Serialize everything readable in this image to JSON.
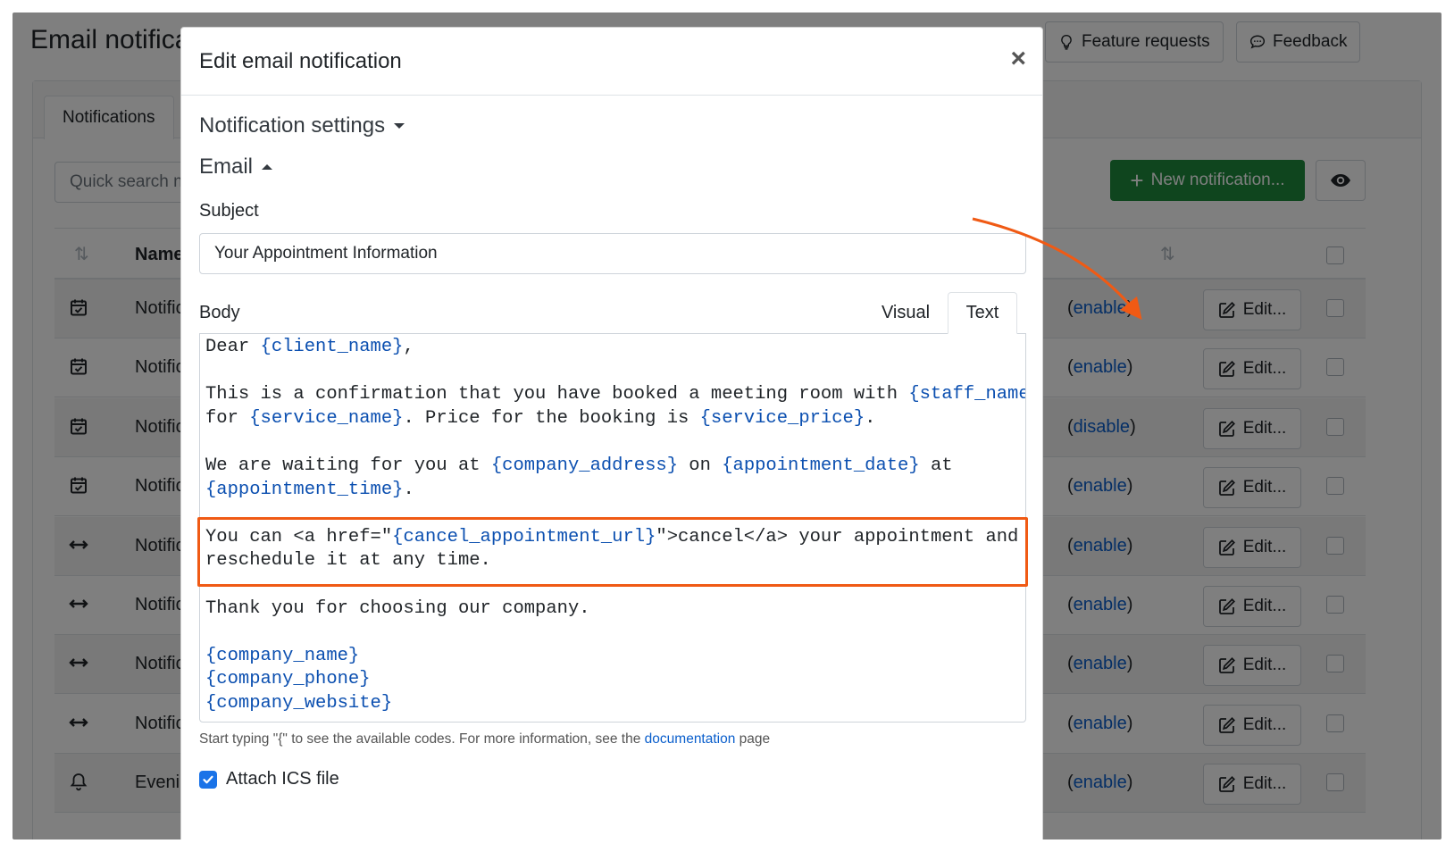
{
  "app": {
    "title": "Email notifica",
    "feature_requests": "Feature requests",
    "feedback": "Feedback",
    "tab_notifications": "Notifications",
    "search_placeholder": "Quick search n",
    "new_notification": "New notification...",
    "column_name": "Name",
    "rows": [
      {
        "icon": "calendar-check-icon",
        "name": "Notificat",
        "state_open": "(",
        "state_link": "enable",
        "state_close": ")",
        "edit": "Edit..."
      },
      {
        "icon": "calendar-check-icon",
        "name": "Notificat",
        "state_open": "(",
        "state_link": "enable",
        "state_close": ")",
        "edit": "Edit..."
      },
      {
        "icon": "calendar-check-icon",
        "name": "Notificat",
        "state_open": "(",
        "state_link": "disable",
        "state_close": ")",
        "edit": "Edit..."
      },
      {
        "icon": "calendar-check-icon",
        "name": "Notificat",
        "state_open": "(",
        "state_link": "enable",
        "state_close": ")",
        "edit": "Edit..."
      },
      {
        "icon": "arrows-horizontal-icon",
        "name": "Notificat",
        "state_open": "(",
        "state_link": "enable",
        "state_close": ")",
        "edit": "Edit..."
      },
      {
        "icon": "arrows-horizontal-icon",
        "name": "Notificat",
        "state_open": "(",
        "state_link": "enable",
        "state_close": ")",
        "edit": "Edit..."
      },
      {
        "icon": "arrows-horizontal-icon",
        "name": "Notificat",
        "state_open": "(",
        "state_link": "enable",
        "state_close": ")",
        "edit": "Edit..."
      },
      {
        "icon": "arrows-horizontal-icon",
        "name": "Notificat",
        "state_open": "(",
        "state_link": "enable",
        "state_close": ")",
        "edit": "Edit..."
      },
      {
        "icon": "bell-icon",
        "name": "Evening",
        "state_open": "(",
        "state_link": "enable",
        "state_close": ")",
        "edit": "Edit..."
      }
    ]
  },
  "modal": {
    "title": "Edit email notification",
    "close": "×",
    "notification_settings": "Notification settings",
    "email_section": "Email",
    "subject_label": "Subject",
    "subject_value": "Your Appointment Information",
    "body_label": "Body",
    "tab_visual": "Visual",
    "tab_text": "Text",
    "body_lines": [
      [
        {
          "t": "Dear "
        },
        {
          "c": "{client_name}"
        },
        {
          "t": ","
        }
      ],
      [],
      [
        {
          "t": "This is a confirmation that you have booked a meeting room with "
        },
        {
          "c": "{staff_name}"
        }
      ],
      [
        {
          "t": "for "
        },
        {
          "c": "{service_name}"
        },
        {
          "t": ". Price for the booking is "
        },
        {
          "c": "{service_price}"
        },
        {
          "t": "."
        }
      ],
      [],
      [
        {
          "t": "We are waiting for you at "
        },
        {
          "c": "{company_address}"
        },
        {
          "t": " on "
        },
        {
          "c": "{appointment_date}"
        },
        {
          "t": " at"
        }
      ],
      [
        {
          "c": "{appointment_time}"
        },
        {
          "t": "."
        }
      ],
      [],
      [
        {
          "t": "You can <a href=\""
        },
        {
          "c": "{cancel_appointment_url}"
        },
        {
          "t": "\">cancel</a> your appointment and"
        }
      ],
      [
        {
          "t": "reschedule it at any time."
        }
      ],
      [],
      [
        {
          "t": "Thank you for choosing our company."
        }
      ],
      [],
      [
        {
          "c": "{company_name}"
        }
      ],
      [
        {
          "c": "{company_phone}"
        }
      ],
      [
        {
          "c": "{company_website}"
        }
      ]
    ],
    "hint_before": "Start typing \"{\" to see the available codes. For more information, see the ",
    "hint_link": "documentation",
    "hint_after": " page",
    "attach_ics": "Attach ICS file",
    "attach_ics_checked": true
  },
  "colors": {
    "accent_green": "#1e8a3c",
    "link_blue": "#0b5fcc",
    "highlight_orange": "#f05a14"
  }
}
